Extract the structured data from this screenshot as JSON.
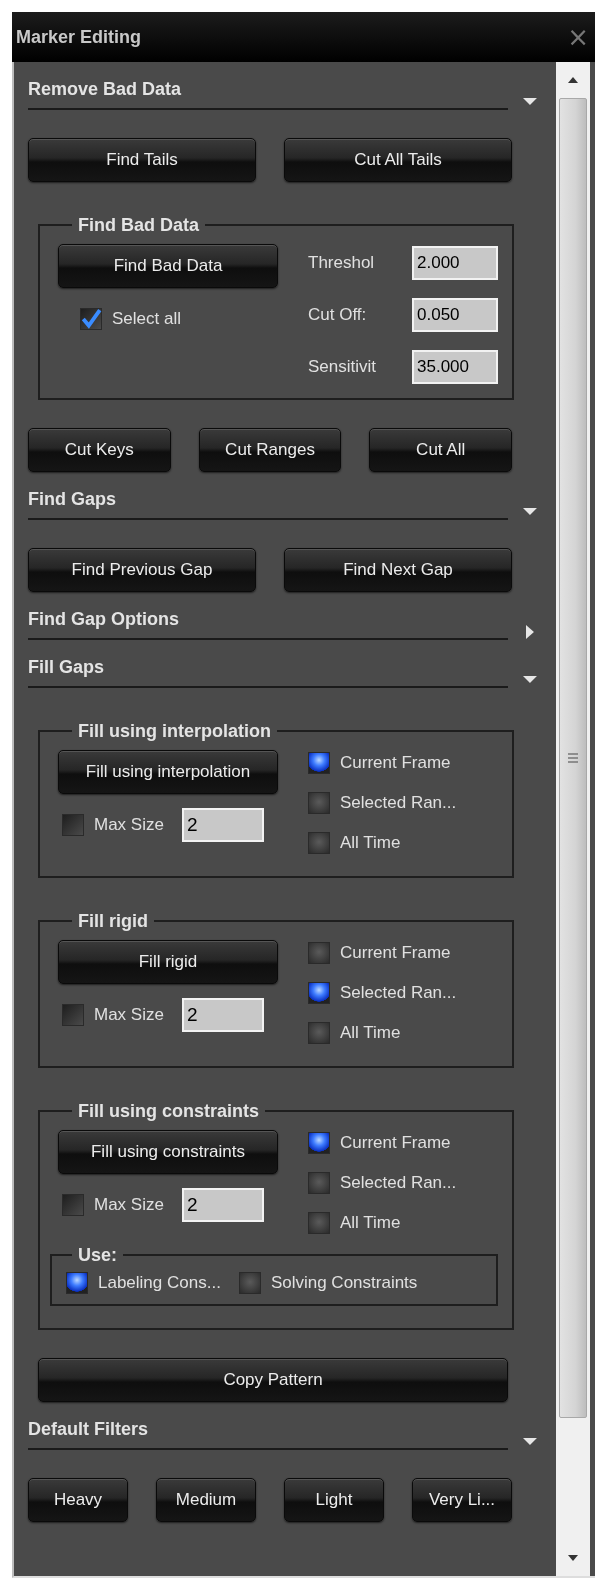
{
  "window": {
    "title": "Marker Editing",
    "close": "×"
  },
  "sections": [
    {
      "title": "Remove Bad Data",
      "expanded": true,
      "items": [
        {
          "kind": "buttons",
          "buttons": [
            "Find Tails",
            "Cut All Tails"
          ]
        },
        {
          "kind": "bad_data",
          "title": "Find Bad Data",
          "button": "Find Bad Data",
          "select_all": {
            "label": "Select all",
            "checked": true
          },
          "fields": [
            {
              "label": "Threshol",
              "value": "2.000"
            },
            {
              "label": "Cut Off:",
              "value": "0.050"
            },
            {
              "label": "Sensitivit",
              "value": "35.000"
            }
          ]
        },
        {
          "kind": "buttons",
          "buttons": [
            "Cut Keys",
            "Cut Ranges",
            "Cut All"
          ]
        }
      ]
    },
    {
      "title": "Find Gaps",
      "expanded": true,
      "items": [
        {
          "kind": "buttons",
          "buttons": [
            "Find Previous Gap",
            "Find Next Gap"
          ]
        }
      ]
    },
    {
      "title": "Find Gap Options",
      "expanded": false
    },
    {
      "title": "Fill Gaps",
      "expanded": true,
      "items": [
        {
          "kind": "fill",
          "title": "Fill using interpolation",
          "button": "Fill using interpolation",
          "max_size": {
            "label": "Max Size",
            "checked": false,
            "value": "2"
          },
          "ranges": [
            {
              "label": "Current Frame",
              "selected": true
            },
            {
              "label": "Selected Ran...",
              "selected": false
            },
            {
              "label": "All Time",
              "selected": false
            }
          ]
        },
        {
          "kind": "fill",
          "title": "Fill rigid",
          "button": "Fill rigid",
          "max_size": {
            "label": "Max Size",
            "checked": false,
            "value": "2"
          },
          "ranges": [
            {
              "label": "Current Frame",
              "selected": false
            },
            {
              "label": "Selected Ran...",
              "selected": true
            },
            {
              "label": "All Time",
              "selected": false
            }
          ]
        },
        {
          "kind": "fill",
          "title": "Fill using constraints",
          "button": "Fill using constraints",
          "max_size": {
            "label": "Max Size",
            "checked": false,
            "value": "2"
          },
          "ranges": [
            {
              "label": "Current Frame",
              "selected": true
            },
            {
              "label": "Selected Ran...",
              "selected": false
            },
            {
              "label": "All Time",
              "selected": false
            }
          ],
          "use": {
            "title": "Use:",
            "options": [
              {
                "label": "Labeling Cons...",
                "selected": true
              },
              {
                "label": "Solving Constraints",
                "selected": false
              }
            ]
          }
        },
        {
          "kind": "wide_button",
          "label": "Copy Pattern"
        }
      ]
    },
    {
      "title": "Default Filters",
      "expanded": true,
      "items": [
        {
          "kind": "buttons",
          "buttons": [
            "Heavy",
            "Medium",
            "Light",
            "Very Li..."
          ]
        }
      ]
    }
  ]
}
